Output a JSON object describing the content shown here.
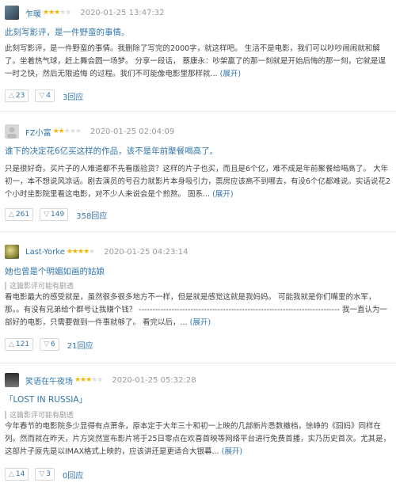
{
  "reviews": [
    {
      "username": "乍暖",
      "rating": 3,
      "time": "2020-01-25 13:47:32",
      "title": "此刻写影评，是一件野蛮的事情。",
      "spoiler": "",
      "body": "此刻写影评，是一件野蛮的事情。我删除了写完的2000字，就这样吧。 生活不是电影，我们可以吵吵闹闹就和解了。坐着热气球，赶上舞会圆一场梦。 分享一段话， 蔡康永：吵架赢了的那一刻就是开始后悔的那一刻，它就是逞一时之快，然后无限追悔 的过程。我们不可能像电影里那样就...",
      "expand": "(展开)",
      "upvotes": "23",
      "downvotes": "4",
      "replies": "3回应",
      "avatar_colors": [
        "#6a8aa0",
        "#2e3d4a"
      ]
    },
    {
      "username": "FZ小富",
      "rating": 2,
      "time": "2020-01-25 02:04:09",
      "title": "谁下的决定花6亿买这样的作品，该不是年前聚餐喝高了。",
      "spoiler": "",
      "body": "只是很好奇，买片子的人难道都不先看版验货？这样的片子也买，而且是6个亿，难不成是年前聚餐给喝高了。 大年初一，本不想说风凉话。剧去演员的号召力就影片本身吸引力，票房应该高不到哪去，有没6个亿都难说。实话说花2个小时坐影院里看这电影，对不少人来说会是个煎熬。 固系...",
      "expand": "(展开)",
      "upvotes": "261",
      "downvotes": "149",
      "replies": "358回应",
      "avatar_colors": [
        "#d8d8d8",
        "#bdbdbd"
      ]
    },
    {
      "username": "Last-Yorke",
      "rating": 4,
      "time": "2020-01-25 04:23:14",
      "title": "她也曾是个明媚如画的姑娘",
      "spoiler": "这篇影评可能有剧透",
      "body": "看电影最大的感受就是，虽然很多很多地方不一样，但是就是感觉这就是我妈妈。 可能我就是你们嘴里的水军，那。。有没有兄弟给个群号让我赚个钱？ -------------------------------------------------------------------------- 我一直认为一部好的电影，只需要做到一件事就够了。 看完以后，...",
      "expand": "(展开)",
      "upvotes": "121",
      "downvotes": "6",
      "replies": "21回应",
      "avatar_colors": [
        "#c9b87a",
        "#5e6b3a"
      ]
    },
    {
      "username": "笑语在午夜场",
      "rating": 3,
      "time": "2020-01-25 05:32:28",
      "title": "「LOST IN RUSSIA」",
      "spoiler": "这篇影评可能有剧透",
      "body": "今年春节的电影院多少显得有点萧条，原本定于大年三十和初一上映的几部新片悉数撤档，徐峥的《囧妈》同样在列。然而就在昨天，片方突然宣布影片将于25日零点在欢喜首映等网络平台进行免费首播，实乃历史首次。尤其是，这部片子原先是以IMAX格式上映的，应该讲还是更适合大银幕...",
      "expand": "(展开)",
      "upvotes": "14",
      "downvotes": "3",
      "replies": "0回应",
      "avatar_colors": [
        "#333333",
        "#888888"
      ]
    }
  ]
}
